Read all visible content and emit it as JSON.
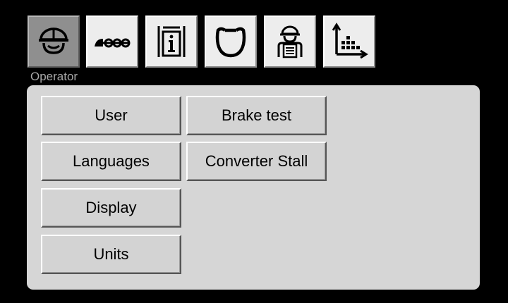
{
  "toolbar": {
    "tabs": [
      {
        "id": "operator",
        "icon": "operator-helmet-icon",
        "active": true
      },
      {
        "id": "machine",
        "icon": "machine-icon",
        "active": false
      },
      {
        "id": "info",
        "icon": "info-document-icon",
        "active": false
      },
      {
        "id": "ring",
        "icon": "ring-icon",
        "active": false
      },
      {
        "id": "technician",
        "icon": "technician-clipboard-icon",
        "active": false
      },
      {
        "id": "statistics",
        "icon": "bar-chart-icon",
        "active": false
      }
    ],
    "active_tab_caption": "Operator"
  },
  "menu": {
    "user": "User",
    "languages": "Languages",
    "display": "Display",
    "units": "Units",
    "brake_test": "Brake test",
    "converter_stall": "Converter Stall"
  },
  "colors": {
    "background": "#000000",
    "panel": "#d6d6d6",
    "button": "#d3d3d3",
    "tab": "#ededed",
    "tab_active": "#8f8f8f",
    "caption": "#a7a7a7"
  }
}
